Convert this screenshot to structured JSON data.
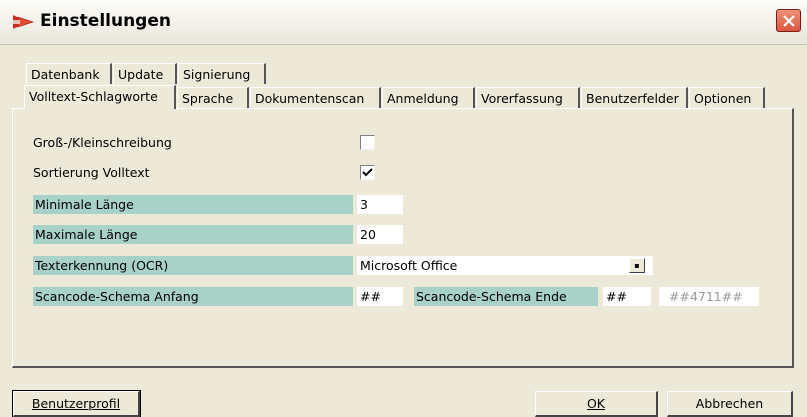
{
  "window": {
    "title": "Einstellungen"
  },
  "tabs": {
    "row1": [
      "Datenbank",
      "Update",
      "Signierung"
    ],
    "row2": [
      "Volltext-Schlagworte",
      "Sprache",
      "Dokumentenscan",
      "Anmeldung",
      "Vorerfassung",
      "Benutzerfelder",
      "Optionen"
    ],
    "active": "Volltext-Schlagworte"
  },
  "form": {
    "case_sensitive": {
      "label": "Groß-/Kleinschreibung",
      "checked": false
    },
    "sort_fulltext": {
      "label": "Sortierung Volltext",
      "checked": true
    },
    "min_length": {
      "label": "Minimale Länge",
      "value": "3"
    },
    "max_length": {
      "label": "Maximale Länge",
      "value": "20"
    },
    "ocr": {
      "label": "Texterkennung (OCR)",
      "value": "Microsoft Office"
    },
    "scancode_start": {
      "label": "Scancode-Schema Anfang",
      "value": "##"
    },
    "scancode_end": {
      "label": "Scancode-Schema Ende",
      "value": "##",
      "example": "##4711##"
    }
  },
  "buttons": {
    "profile": "Benutzerprofil",
    "ok": "OK",
    "cancel": "Abbrechen"
  },
  "colors": {
    "label_bg": "#a8d1c8",
    "dialog_bg": "#ece9d8",
    "close_red": "#d8573e"
  },
  "icons": {
    "app": "scanner-arrow-icon",
    "close": "close-icon",
    "dropdown": "dropdown-arrow-icon",
    "check": "checkmark-icon"
  }
}
